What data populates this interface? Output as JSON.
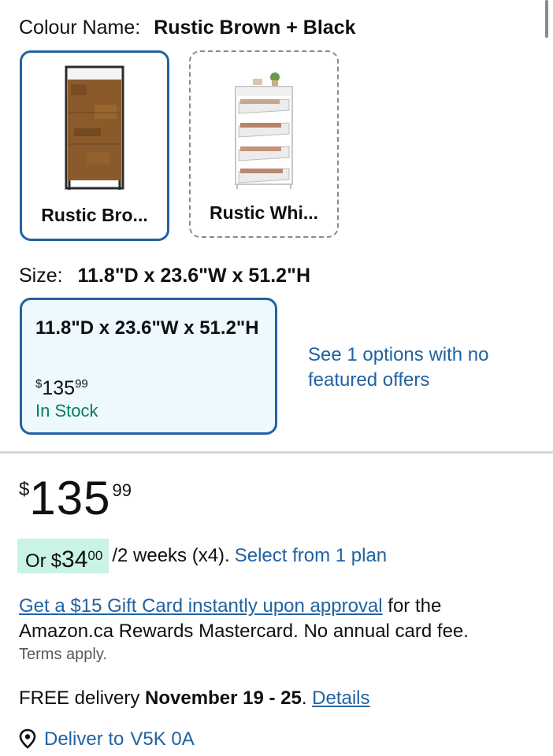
{
  "colour": {
    "label": "Colour Name:",
    "value": "Rustic Brown + Black",
    "options": [
      {
        "label": "Rustic Bro...",
        "icon": "rustic-brown-cabinet-image"
      },
      {
        "label": "Rustic Whi...",
        "icon": "rustic-white-shoe-cabinet-image"
      }
    ]
  },
  "size": {
    "label": "Size:",
    "value": "11.8\"D x 23.6\"W x 51.2\"H",
    "option": {
      "title": "11.8\"D x 23.6\"W x 51.2\"H",
      "price_symbol": "$",
      "price_whole": "135",
      "price_cents": "99",
      "stock": "In Stock"
    },
    "see_options": "See 1 options with no featured offers"
  },
  "price": {
    "symbol": "$",
    "whole": "135",
    "cents": "99"
  },
  "plan": {
    "prefix": "Or",
    "symbol": "$",
    "whole": "34",
    "cents": "00",
    "period": "/2 weeks (x4).",
    "link": "Select from 1 plan"
  },
  "gift": {
    "link": "Get a $15 Gift Card instantly upon approval",
    "text": " for the Amazon.ca Rewards Mastercard. No annual card fee.",
    "terms": "Terms apply."
  },
  "delivery": {
    "prefix": "FREE delivery ",
    "date": "November 19 - 25",
    "suffix": ". ",
    "details": "Details",
    "deliver_to_label": "Deliver to",
    "postal_code": "V5K 0A",
    "icon": "location-pin-icon"
  },
  "colors": {
    "link": "#2162a1",
    "selected_border": "#2162a1",
    "in_stock": "#067d62",
    "plan_chip": "#c8f3e5"
  }
}
